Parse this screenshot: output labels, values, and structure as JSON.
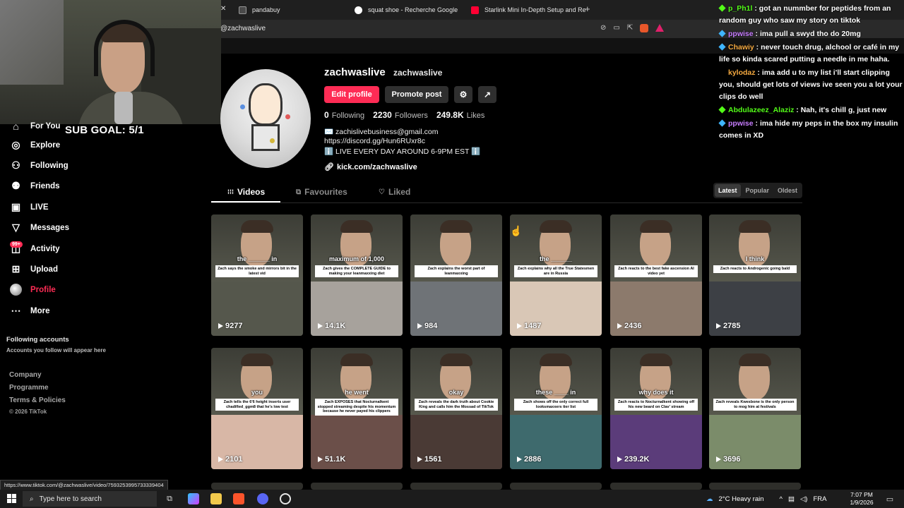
{
  "browser": {
    "tabs": [
      {
        "label": "pandabuy",
        "favicon_color": "#4a4a4a"
      },
      {
        "label": "squat shoe - Recherche Google",
        "favicon_color": "#ffffff"
      },
      {
        "label": "Starlink Mini In-Depth Setup and Re",
        "favicon_color": "#ff0033"
      }
    ],
    "new_tab": "+",
    "close": "✕",
    "url": "@zachwaslive"
  },
  "stream": {
    "sub_goal": "SUB GOAL: 5/1"
  },
  "sidebar": {
    "items": [
      {
        "label": "For You",
        "icon": "home-icon",
        "glyph": "⌂"
      },
      {
        "label": "Explore",
        "icon": "compass-icon",
        "glyph": "◎"
      },
      {
        "label": "Following",
        "icon": "user-plus-icon",
        "glyph": "⚇"
      },
      {
        "label": "Friends",
        "icon": "friends-icon",
        "glyph": "⚉"
      },
      {
        "label": "LIVE",
        "icon": "live-icon",
        "glyph": "▣"
      },
      {
        "label": "Messages",
        "icon": "messages-icon",
        "glyph": "▽"
      },
      {
        "label": "Activity",
        "icon": "activity-icon",
        "glyph": "◫"
      },
      {
        "label": "Upload",
        "icon": "upload-icon",
        "glyph": "⊞"
      },
      {
        "label": "Profile",
        "icon": "profile-avatar",
        "glyph": ""
      },
      {
        "label": "More",
        "icon": "more-icon",
        "glyph": "⋯"
      }
    ],
    "activity_badge": "99+",
    "following_accounts": "Following accounts",
    "following_sub": "Accounts you follow will appear here",
    "footer": [
      "Company",
      "Programme",
      "Terms & Policies"
    ],
    "copyright": "© 2026 TikTok"
  },
  "profile": {
    "username": "zachwaslive",
    "handle": "zachwaslive",
    "edit_button": "Edit profile",
    "promote_button": "Promote post",
    "stats": {
      "following": "0",
      "following_label": "Following",
      "followers": "2230",
      "followers_label": "Followers",
      "likes": "249.8K",
      "likes_label": "Likes"
    },
    "bio": [
      "✉️ zachislivebusiness@gmail.com",
      "https://discord.gg/Hun6RUxr8c",
      "ℹ️ LIVE EVERY DAY AROUND 6-9PM EST ℹ️"
    ],
    "link": "kick.com/zachwaslive"
  },
  "tabs": [
    {
      "label": "Videos",
      "icon": "grid-icon",
      "glyph": "⁞⁞⁞"
    },
    {
      "label": "Favourites",
      "icon": "bookmark-icon",
      "glyph": "⧉"
    },
    {
      "label": "Liked",
      "icon": "heart-icon",
      "glyph": "♡"
    }
  ],
  "sort": [
    "Latest",
    "Popular",
    "Oldest"
  ],
  "videos": [
    {
      "views": "9277",
      "caption": "Zach says the smoke and mirrors bit in the latest vid",
      "big": "the ______ in"
    },
    {
      "views": "14.1K",
      "caption": "Zach gives the COMPLETE GUIDE to making your leanmaxxing diet",
      "big": "maximum of 1,000"
    },
    {
      "views": "984",
      "caption": "Zach explains the worst part of leanmaxxing",
      "big": ""
    },
    {
      "views": "1487",
      "caption": "Zach explains why all the True Statesmen are in Russia",
      "big": "the ______"
    },
    {
      "views": "2436",
      "caption": "Zach reacts to the best fake ascension AI video yet",
      "big": ""
    },
    {
      "views": "2785",
      "caption": "Zach reacts to Androgenic going bald",
      "big": "I think"
    },
    {
      "views": "2101",
      "caption": "Zach tells the 6'6 height inserts user chadified_ggm8 that he's low test",
      "big": "you"
    },
    {
      "views": "51.1K",
      "caption": "Zach EXPOSES that Nocturnalkent stopped streaming despite his momentum because he never payed his clippers",
      "big": "he went"
    },
    {
      "views": "1561",
      "caption": "Zach reveals the dark truth about Cookie King and calls him the Mossad of TikTok",
      "big": "okay"
    },
    {
      "views": "2886",
      "caption": "Zach shows off the only correct full looksmaxxers tier list",
      "big": "these ____ in"
    },
    {
      "views": "239.2K",
      "caption": "Zach reacts to Nocturnalkent showing off his new beard on Clav' stream",
      "big": "why does it"
    },
    {
      "views": "3696",
      "caption": "Zach reveals Kwesbone is the only person to mog him at festivals",
      "big": ""
    }
  ],
  "chat": [
    {
      "user": "p_Ph1l",
      "color": "#53fc18",
      "badge": "green",
      "text": "got an nummber for peptides from an random guy who saw my story on tiktok"
    },
    {
      "user": "ppwise",
      "color": "#c77dff",
      "badge": "blue",
      "text": "ima pull a swyd tho do 20mg"
    },
    {
      "user": "Chawiy",
      "color": "#f4a940",
      "badge": "blue",
      "text": "never touch drug, alchool or café in my life so kinda scared putting a needle in me haha."
    },
    {
      "user": "kylodaz",
      "color": "#f4a940",
      "badge": "",
      "text": "ima add u to my list i'll start clipping you, should get lots of views ive seen you a lot your clips do well"
    },
    {
      "user": "Abdulazeez_Alaziz",
      "color": "#53fc18",
      "badge": "green",
      "text": "Nah, it's chill g, just new"
    },
    {
      "user": "ppwise",
      "color": "#c77dff",
      "badge": "blue",
      "text": "ima hide my peps in the box my insulin comes in XD"
    }
  ],
  "status_url": "https://www.tiktok.com/@zachwaslive/video/7593253995733339404",
  "taskbar": {
    "search_placeholder": "Type here to search",
    "weather": "2°C  Heavy rain",
    "lang": "FRA",
    "time": "7:07 PM",
    "date": "1/9/2026"
  },
  "colors": {
    "accent": "#fe2c55",
    "background": "#000000"
  }
}
